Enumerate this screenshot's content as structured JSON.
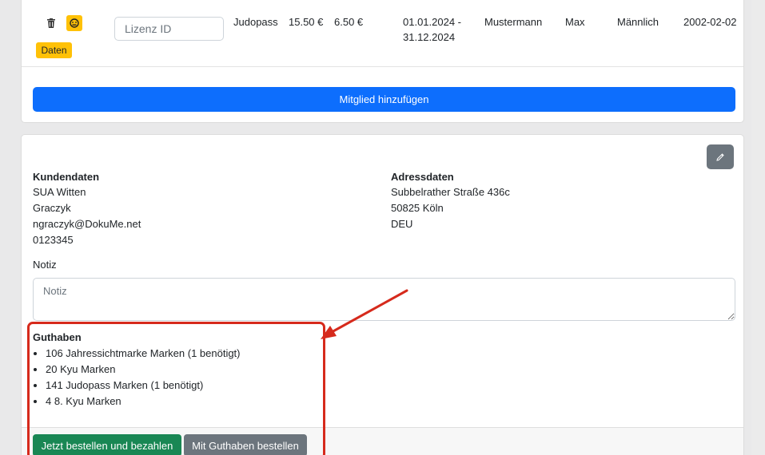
{
  "member_row": {
    "lizenz_placeholder": "Lizenz ID",
    "daten_label": "Daten",
    "pass_type": "Judopass",
    "price1": "15.50 €",
    "price2": "6.50 €",
    "date_from": "01.01.2024 -",
    "date_to": "31.12.2024",
    "last_name": "Mustermann",
    "first_name": "Max",
    "gender": "Männlich",
    "birthdate": "2002-02-02"
  },
  "add_member_label": "Mitglied hinzufügen",
  "kundendaten": {
    "title": "Kundendaten",
    "lines": [
      "SUA Witten",
      "Graczyk",
      "ngraczyk@DokuMe.net",
      "0123345"
    ]
  },
  "adressdaten": {
    "title": "Adressdaten",
    "lines": [
      "Subbelrather Straße 436c",
      "50825 Köln",
      "DEU"
    ]
  },
  "notiz": {
    "label": "Notiz",
    "placeholder": "Notiz"
  },
  "guthaben": {
    "title": "Guthaben",
    "items": [
      "106 Jahressichtmarke Marken (1 benötigt)",
      "20 Kyu Marken",
      "141 Judopass Marken (1 benötigt)",
      "4 8. Kyu Marken"
    ]
  },
  "footer": {
    "order_pay_label": "Jetzt bestellen und bezahlen",
    "order_credit_label": "Mit Guthaben bestellen"
  },
  "colors": {
    "primary": "#0d6efd",
    "success": "#198754",
    "secondary": "#6c757d",
    "warning": "#ffc107",
    "annotation": "#d62a1c"
  },
  "icons": {
    "delete": "trash-icon",
    "face": "user-face-icon",
    "edit": "pencil-icon"
  }
}
